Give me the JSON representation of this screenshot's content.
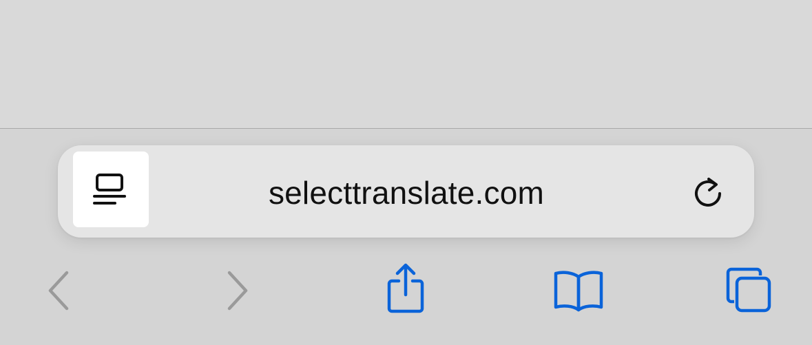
{
  "address_bar": {
    "url": "selecttranslate.com",
    "reader_icon": "reader-mode-icon",
    "reload_icon": "reload-icon"
  },
  "bottom_toolbar": {
    "buttons": [
      {
        "name": "back",
        "icon": "chevron-left-icon",
        "enabled": false
      },
      {
        "name": "forward",
        "icon": "chevron-right-icon",
        "enabled": false
      },
      {
        "name": "share",
        "icon": "share-icon",
        "enabled": true
      },
      {
        "name": "bookmarks",
        "icon": "book-icon",
        "enabled": true
      },
      {
        "name": "tabs",
        "icon": "tabs-icon",
        "enabled": true
      }
    ]
  },
  "colors": {
    "accent": "#0a63d9",
    "disabled": "#9a9a9a",
    "text": "#111111"
  }
}
